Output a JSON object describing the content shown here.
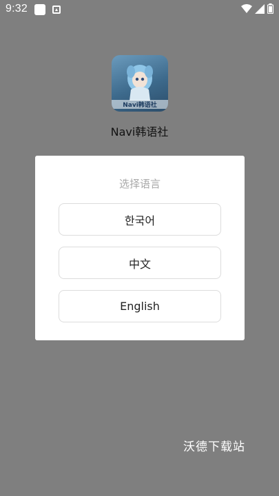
{
  "status_bar": {
    "time": "9:32",
    "icons": [
      "square-notification-icon",
      "a-notification-icon",
      "wifi-icon",
      "signal-icon",
      "battery-icon"
    ]
  },
  "app": {
    "logo_text": "Navi韩语社",
    "name": "Navi韩语社"
  },
  "dialog": {
    "title": "选择语言",
    "options": [
      "한국어",
      "中文",
      "English"
    ]
  },
  "watermark": "沃德下载站",
  "colors": {
    "overlay": "#7f7f7f",
    "dialog_bg": "#ffffff",
    "title_text": "#a8a8a8",
    "button_border": "#dcdcdc"
  }
}
